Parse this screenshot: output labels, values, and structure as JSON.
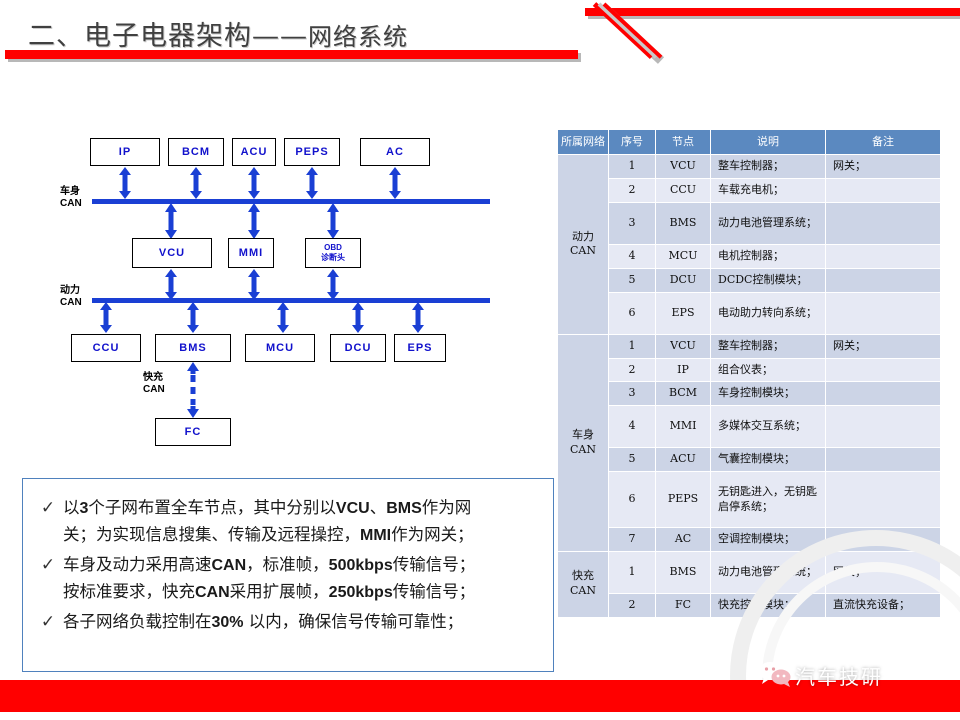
{
  "slide": {
    "title_main": "二、电子电器架构——",
    "title_sub": "网络系统",
    "accent_red": "#ff0000",
    "table_header_blue": "#5b89c0",
    "row_dark": "#ccd4e6",
    "row_light": "#e6e9f4",
    "diagram_blue": "#1a3fd4"
  },
  "diagram": {
    "top_nodes": [
      {
        "label": "IP"
      },
      {
        "label": "BCM"
      },
      {
        "label": "ACU"
      },
      {
        "label": "PEPS"
      },
      {
        "label": "AC"
      }
    ],
    "middle_nodes": [
      {
        "label": "VCU"
      },
      {
        "label": "MMI"
      },
      {
        "label_line1": "OBD",
        "label_line2": "诊断头"
      }
    ],
    "bottom_nodes": [
      {
        "label": "CCU"
      },
      {
        "label": "BMS"
      },
      {
        "label": "MCU"
      },
      {
        "label": "DCU"
      },
      {
        "label": "EPS"
      }
    ],
    "fc_node": {
      "label": "FC"
    },
    "bus_labels": [
      {
        "line1": "车身",
        "line2": "CAN"
      },
      {
        "line1": "动力",
        "line2": "CAN"
      }
    ],
    "fast_charge_label": {
      "line1": "快充",
      "line2": "CAN"
    }
  },
  "table": {
    "headers": [
      "所属网络",
      "序号",
      "节点",
      "说明",
      "备注"
    ],
    "groups": [
      {
        "network": "动力\nCAN",
        "network_line1": "动力",
        "network_line2": "CAN",
        "rows": [
          {
            "no": "1",
            "node": "VCU",
            "desc": "整车控制器；",
            "note": "网关；"
          },
          {
            "no": "2",
            "node": "CCU",
            "desc": "车载充电机；",
            "note": ""
          },
          {
            "no": "3",
            "node": "BMS",
            "desc": "动力电池管理系统；",
            "note": ""
          },
          {
            "no": "4",
            "node": "MCU",
            "desc": "电机控制器；",
            "note": ""
          },
          {
            "no": "5",
            "node": "DCU",
            "desc": "DCDC控制模块；",
            "note": ""
          },
          {
            "no": "6",
            "node": "EPS",
            "desc": "电动助力转向系统；",
            "note": ""
          }
        ]
      },
      {
        "network": "车身\nCAN",
        "network_line1": "车身",
        "network_line2": "CAN",
        "rows": [
          {
            "no": "1",
            "node": "VCU",
            "desc": "整车控制器；",
            "note": "网关；"
          },
          {
            "no": "2",
            "node": "IP",
            "desc": "组合仪表；",
            "note": ""
          },
          {
            "no": "3",
            "node": "BCM",
            "desc": "车身控制模块；",
            "note": ""
          },
          {
            "no": "4",
            "node": "MMI",
            "desc": "多媒体交互系统；",
            "note": ""
          },
          {
            "no": "5",
            "node": "ACU",
            "desc": "气囊控制模块；",
            "note": ""
          },
          {
            "no": "6",
            "node": "PEPS",
            "desc": "无钥匙进入，无钥匙启停系统；",
            "note": ""
          },
          {
            "no": "7",
            "node": "AC",
            "desc": "空调控制模块；",
            "note": ""
          }
        ]
      },
      {
        "network": "快充\nCAN",
        "network_line1": "快充",
        "network_line2": "CAN",
        "rows": [
          {
            "no": "1",
            "node": "BMS",
            "desc": "动力电池管理系统；",
            "note": "网关；"
          },
          {
            "no": "2",
            "node": "FC",
            "desc": "快充控制模块；",
            "note": "直流快充设备；"
          }
        ]
      }
    ]
  },
  "bullets": {
    "tick_glyph": "✓",
    "items": [
      {
        "line1_a": "以",
        "line1_b": "3",
        "line1_c": "个子网布置全车节点，其中分别以",
        "line1_d": "VCU",
        "line1_e": "、",
        "line1_f": "BMS",
        "line1_g": "作为网",
        "line2_a": "关；为实现信息搜集、传输及远程操控，",
        "line2_b": "MMI",
        "line2_c": "作为网关；"
      },
      {
        "line1_a": "车身及动力采用高速",
        "line1_b": "CAN",
        "line1_c": "，标准帧，",
        "line1_d": "500kbps",
        "line1_e": "传输信号；",
        "line2_a": "按标准要求，快充",
        "line2_b": "CAN",
        "line2_c": "采用扩展帧，",
        "line2_d": "250kbps",
        "line2_e": "传输信号；"
      },
      {
        "line1_a": "各子网络负载控制在",
        "line1_b": "30%",
        "line1_c": " 以内，确保信号传输可靠性；"
      }
    ]
  },
  "footer": {
    "brand": "汽车技研",
    "icon": "wechat-icon"
  }
}
